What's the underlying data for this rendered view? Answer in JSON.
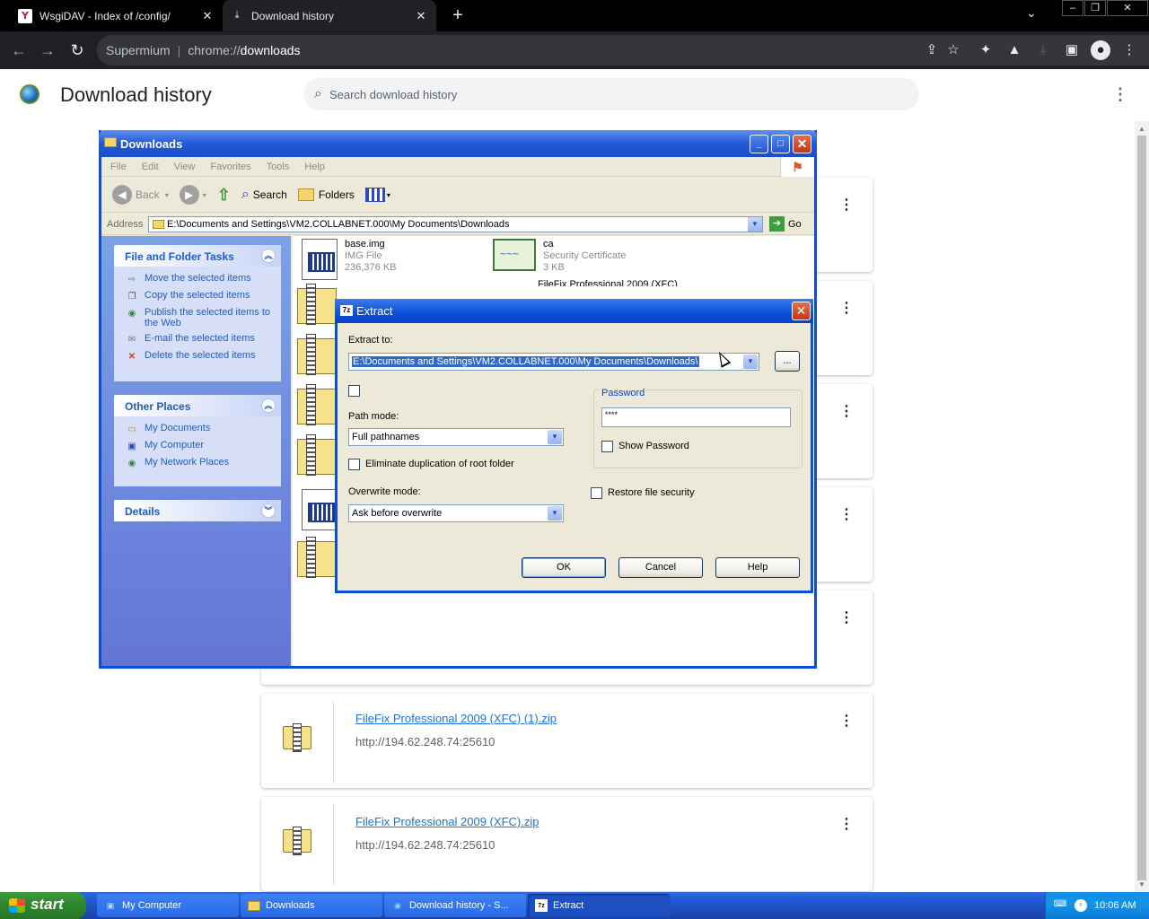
{
  "browser": {
    "tabs": [
      {
        "title": "WsgiDAV - Index of /config/",
        "favicon": "wsgidav-icon"
      },
      {
        "title": "Download history",
        "favicon": "download-icon",
        "active": true
      }
    ],
    "omnibox": {
      "brand": "Supermium",
      "scheme": "chrome://",
      "host": "downloads"
    }
  },
  "downloads_page": {
    "title": "Download history",
    "search_placeholder": "Search download history",
    "items": [
      {
        "file": "FileFix Professional 2009 (XFC) (1).zip",
        "url": "http://194.62.248.74:25610"
      },
      {
        "file": "FileFix Professional 2009 (XFC).zip",
        "url": "http://194.62.248.74:25610"
      }
    ]
  },
  "explorer": {
    "title": "Downloads",
    "menu": [
      "File",
      "Edit",
      "View",
      "Favorites",
      "Tools",
      "Help"
    ],
    "toolbar": {
      "back": "Back",
      "search": "Search",
      "folders": "Folders"
    },
    "address_label": "Address",
    "address": "E:\\Documents and Settings\\VM2.COLLABNET.000\\My Documents\\Downloads",
    "go": "Go",
    "tasks": {
      "header": "File and Folder Tasks",
      "items": [
        "Move the selected items",
        "Copy the selected items",
        "Publish the selected items to the Web",
        "E-mail the selected items",
        "Delete the selected items"
      ]
    },
    "places": {
      "header": "Other Places",
      "items": [
        "My Documents",
        "My Computer",
        "My Network Places"
      ]
    },
    "details_header": "Details",
    "files": [
      {
        "name": "base.img",
        "type": "IMG File",
        "size": "236,376 KB"
      },
      {
        "name": "ca",
        "type": "Security Certificate",
        "size": "3 KB"
      },
      {
        "name": "FileFix Professional 2009 (XFC)"
      }
    ]
  },
  "extract_dialog": {
    "title": "Extract",
    "extract_to_label": "Extract to:",
    "extract_to_value": "E:\\Documents and Settings\\VM2.COLLABNET.000\\My Documents\\Downloads\\",
    "browse_label": "...",
    "path_mode_label": "Path mode:",
    "path_mode_value": "Full pathnames",
    "eliminate_dup_label": "Eliminate duplication of root folder",
    "overwrite_mode_label": "Overwrite mode:",
    "overwrite_mode_value": "Ask before overwrite",
    "password_label": "Password",
    "password_value": "****",
    "show_password_label": "Show Password",
    "restore_security_label": "Restore file security",
    "ok": "OK",
    "cancel": "Cancel",
    "help": "Help"
  },
  "taskbar": {
    "start": "start",
    "tasks": [
      "My Computer",
      "Downloads",
      "Download history - S...",
      "Extract"
    ],
    "clock": "10:06 AM"
  }
}
